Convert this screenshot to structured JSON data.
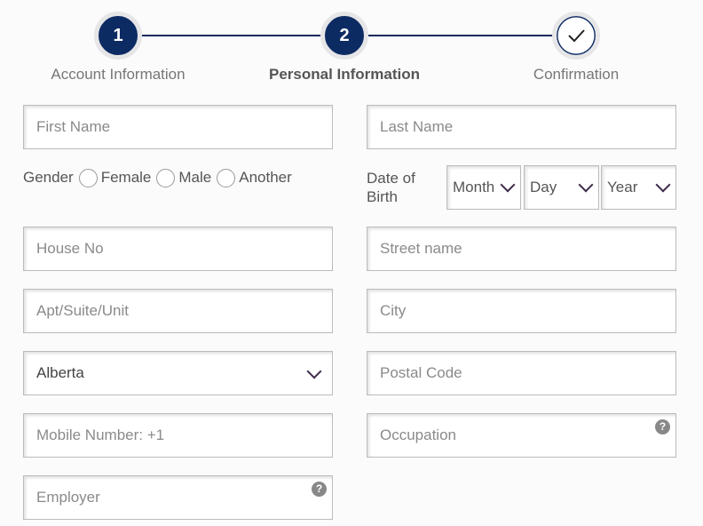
{
  "stepper": {
    "steps": [
      {
        "number": "1",
        "label": "Account Information",
        "state": "completed"
      },
      {
        "number": "2",
        "label": "Personal Information",
        "state": "active"
      },
      {
        "number": "",
        "label": "Confirmation",
        "icon": "check-icon",
        "state": "pending"
      }
    ],
    "color": "#0d2b63"
  },
  "form": {
    "first_name": {
      "placeholder": "First Name"
    },
    "last_name": {
      "placeholder": "Last Name"
    },
    "gender": {
      "label": "Gender",
      "options": [
        "Female",
        "Male",
        "Another"
      ]
    },
    "dob": {
      "label": "Date of Birth",
      "month": "Month",
      "day": "Day",
      "year": "Year"
    },
    "house_no": {
      "placeholder": "House No"
    },
    "street": {
      "placeholder": "Street name"
    },
    "apt": {
      "placeholder": "Apt/Suite/Unit"
    },
    "city": {
      "placeholder": "City"
    },
    "province": {
      "value": "Alberta"
    },
    "postal": {
      "placeholder": "Postal Code"
    },
    "mobile": {
      "placeholder": "Mobile Number: +1"
    },
    "occupation": {
      "placeholder": "Occupation",
      "help": "?"
    },
    "employer": {
      "placeholder": "Employer",
      "help": "?"
    }
  }
}
